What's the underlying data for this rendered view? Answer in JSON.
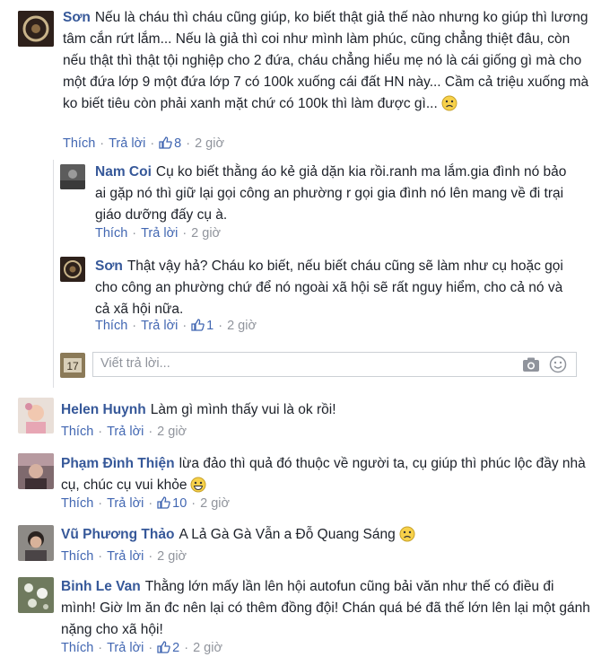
{
  "labels": {
    "like": "Thích",
    "reply": "Trả lời",
    "reply_placeholder": "Viết trả lời..."
  },
  "comments": [
    {
      "name": "Sơn",
      "text": "Nếu là cháu thì cháu cũng giúp, ko biết thật giả thế nào nhưng ko giúp thì lương tâm cắn rứt lắm... Nếu là giả thì coi như mình làm phúc, cũng chẳng thiệt đâu, còn nếu thật thì thật tội nghiệp cho 2 đứa, cháu chẳng hiểu mẹ nó là cái giống gì mà cho một đứa lớp 9 một đứa lớp 7 có 100k xuống cái đất HN này... Cầm cả triệu xuống mà ko biết tiêu còn phải xanh mặt chứ có 100k thì làm được gì...",
      "emoji": "frown-emoji",
      "likes": "8",
      "time": "2 giờ"
    },
    {
      "name": "Nam Coi",
      "text": "Cụ ko biết thằng áo kẻ giả dặn kia rồi.ranh ma lắm.gia đình nó bảo ai gặp nó thì giữ lại gọi công an phường r gọi gia đình nó lên mang về đi trại giáo dưỡng đấy cụ à.",
      "likes": "",
      "time": "2 giờ"
    },
    {
      "name": "Sơn",
      "text": "Thật vậy hả? Cháu ko biết, nếu biết cháu cũng sẽ làm như cụ hoặc gọi cho công an phường chứ để nó ngoài xã hội sẽ rất nguy hiểm, cho cả nó và cả xã hội nữa.",
      "likes": "1",
      "time": "2 giờ"
    },
    {
      "name": "Helen Huynh",
      "text": "Làm gì mình thấy vui là ok rồi!",
      "likes": "",
      "time": "2 giờ"
    },
    {
      "name": "Phạm Đình Thiện",
      "text": "lừa đảo thì quả đó thuộc về người ta, cụ giúp thì phúc lộc đầy nhà cụ, chúc cụ vui khỏe",
      "emoji": "grin-emoji",
      "likes": "10",
      "time": "2 giờ"
    },
    {
      "name": "Vũ Phương Thảo",
      "text": "A Lả Gà Gà Vẫn a Đỗ Quang Sáng",
      "emoji": "frown-emoji",
      "likes": "",
      "time": "2 giờ"
    },
    {
      "name": "Binh Le Van",
      "text": "Thằng lớn mấy lần lên hội autofun cũng bải văn như thế có điều đi mình! Giờ lm ăn đc nên lại có thêm đồng đội! Chán quá bé đã thế lớn lên lại một gánh nặng cho xã hội!",
      "likes": "2",
      "time": "2 giờ"
    }
  ]
}
